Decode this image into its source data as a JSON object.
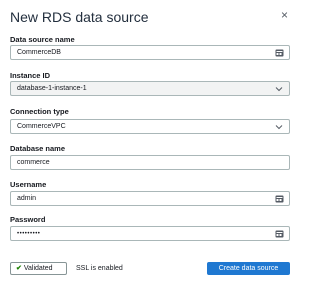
{
  "dialog": {
    "title": "New RDS data source",
    "close_glyph": "×"
  },
  "fields": {
    "data_source_name": {
      "label": "Data source name",
      "value": "CommerceDB"
    },
    "instance_id": {
      "label": "Instance ID",
      "value": "database-1-instance-1"
    },
    "connection_type": {
      "label": "Connection type",
      "value": "CommerceVPC"
    },
    "database_name": {
      "label": "Database name",
      "value": "commerce"
    },
    "username": {
      "label": "Username",
      "value": "admin"
    },
    "password": {
      "label": "Password",
      "value": "•••••••••"
    }
  },
  "footer": {
    "validated_label": "Validated",
    "ssl_text": "SSL is enabled",
    "create_label": "Create data source"
  },
  "icons": {
    "field_key": "key-icon",
    "dropdown": "chevron-down-icon",
    "validated": "checkmark-icon"
  },
  "colors": {
    "primary": "#1f78d1",
    "success": "#1d8102"
  }
}
